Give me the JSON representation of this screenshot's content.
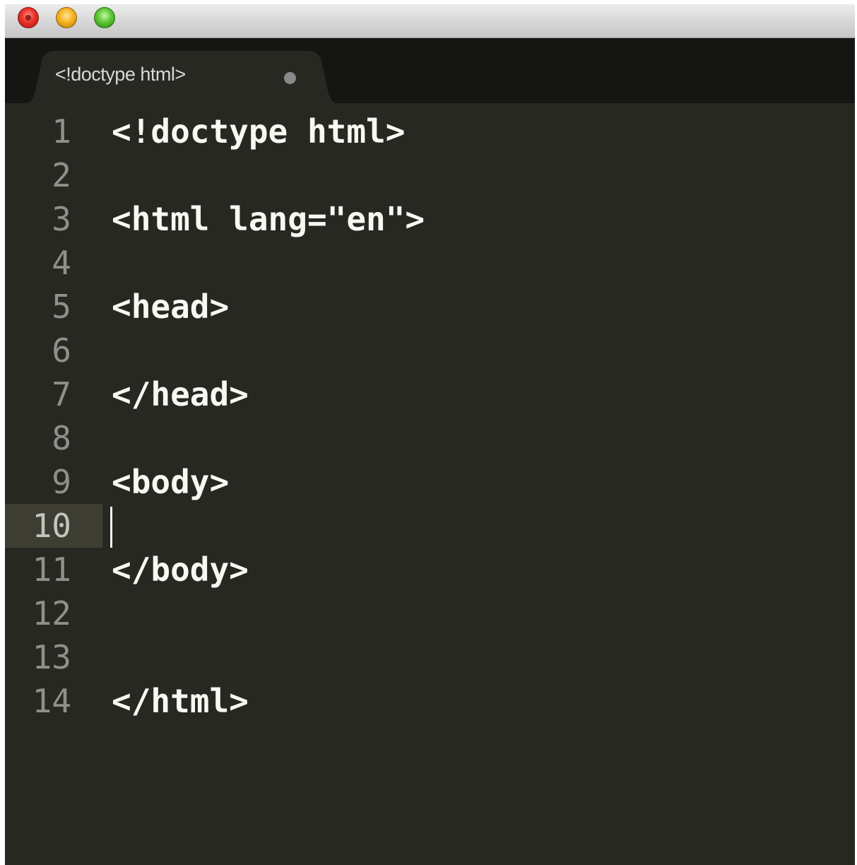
{
  "window": {
    "traffic_lights": [
      {
        "name": "close",
        "color": "#e8322a"
      },
      {
        "name": "minimize",
        "color": "#f5b321"
      },
      {
        "name": "zoom",
        "color": "#5cc736"
      }
    ]
  },
  "tab": {
    "title": "<!doctype html>",
    "modified_indicator": "unsaved-dot-icon"
  },
  "editor": {
    "current_line": 10,
    "lines": [
      {
        "number": "1",
        "text": "<!doctype html>"
      },
      {
        "number": "2",
        "text": ""
      },
      {
        "number": "3",
        "text": "<html lang=\"en\">"
      },
      {
        "number": "4",
        "text": ""
      },
      {
        "number": "5",
        "text": "<head>"
      },
      {
        "number": "6",
        "text": ""
      },
      {
        "number": "7",
        "text": "</head>"
      },
      {
        "number": "8",
        "text": ""
      },
      {
        "number": "9",
        "text": "<body>"
      },
      {
        "number": "10",
        "text": ""
      },
      {
        "number": "11",
        "text": "</body>"
      },
      {
        "number": "12",
        "text": ""
      },
      {
        "number": "13",
        "text": ""
      },
      {
        "number": "14",
        "text": "</html>"
      }
    ]
  },
  "colors": {
    "background": "#272822",
    "foreground": "#f8f8f2",
    "gutter_text": "#8f908a",
    "current_line": "#3e3d32",
    "tab_bar": "#151514"
  }
}
